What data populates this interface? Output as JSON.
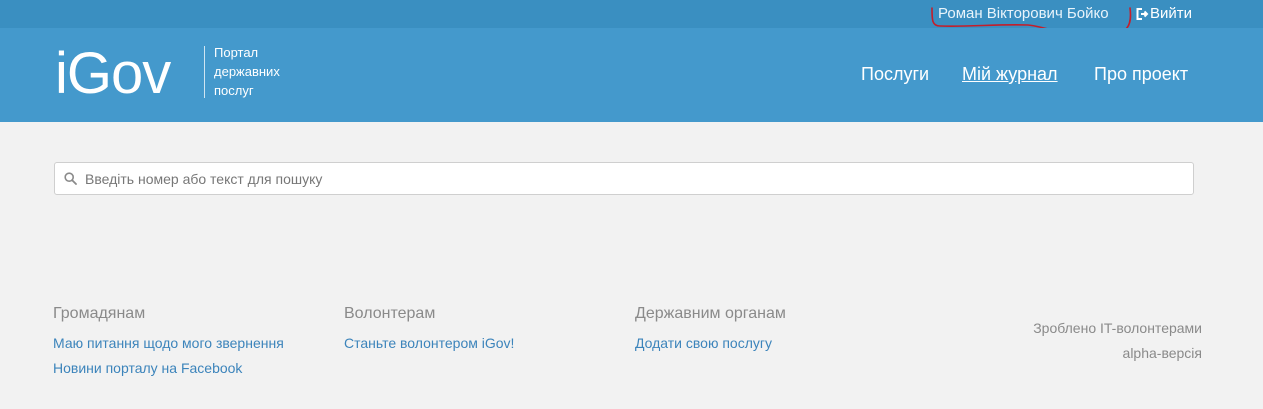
{
  "topbar": {
    "user_name": "Роман Вікторович Бойко",
    "logout_label": "Вийти"
  },
  "header": {
    "logo": "iGov",
    "tagline": [
      "Портал",
      "державних",
      "послуг"
    ],
    "nav": {
      "services": "Послуги",
      "journal": "Мій журнал",
      "about": "Про проект"
    }
  },
  "search": {
    "placeholder": "Введіть номер або текст для пошуку"
  },
  "footer": {
    "citizens": {
      "heading": "Громадянам",
      "links": [
        "Маю питання щодо мого звернення",
        "Новини порталу на Facebook"
      ]
    },
    "volunteers": {
      "heading": "Волонтерам",
      "links": [
        "Станьте волонтером iGov!"
      ]
    },
    "gov": {
      "heading": "Державним органам",
      "links": [
        "Додати свою послугу"
      ]
    },
    "credits": [
      "Зроблено IT-волонтерами",
      "alpha-версія"
    ]
  },
  "colors": {
    "topbar": "#3a8fc1",
    "header": "#4499cc",
    "background": "#f2f2f2",
    "link": "#3c84bb",
    "annotation": "#c41e2a"
  }
}
